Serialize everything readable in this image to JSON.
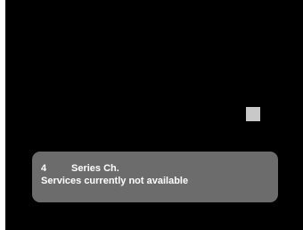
{
  "colors": {
    "background": "#000000",
    "banner": "#6c6c6c",
    "indicator": "#c8c8c8",
    "text": "#ffffff"
  },
  "indicator": {
    "icon": "square-indicator-icon"
  },
  "banner": {
    "channel_number": "4",
    "channel_name": "Series Ch.",
    "message": "Services currently not available"
  }
}
